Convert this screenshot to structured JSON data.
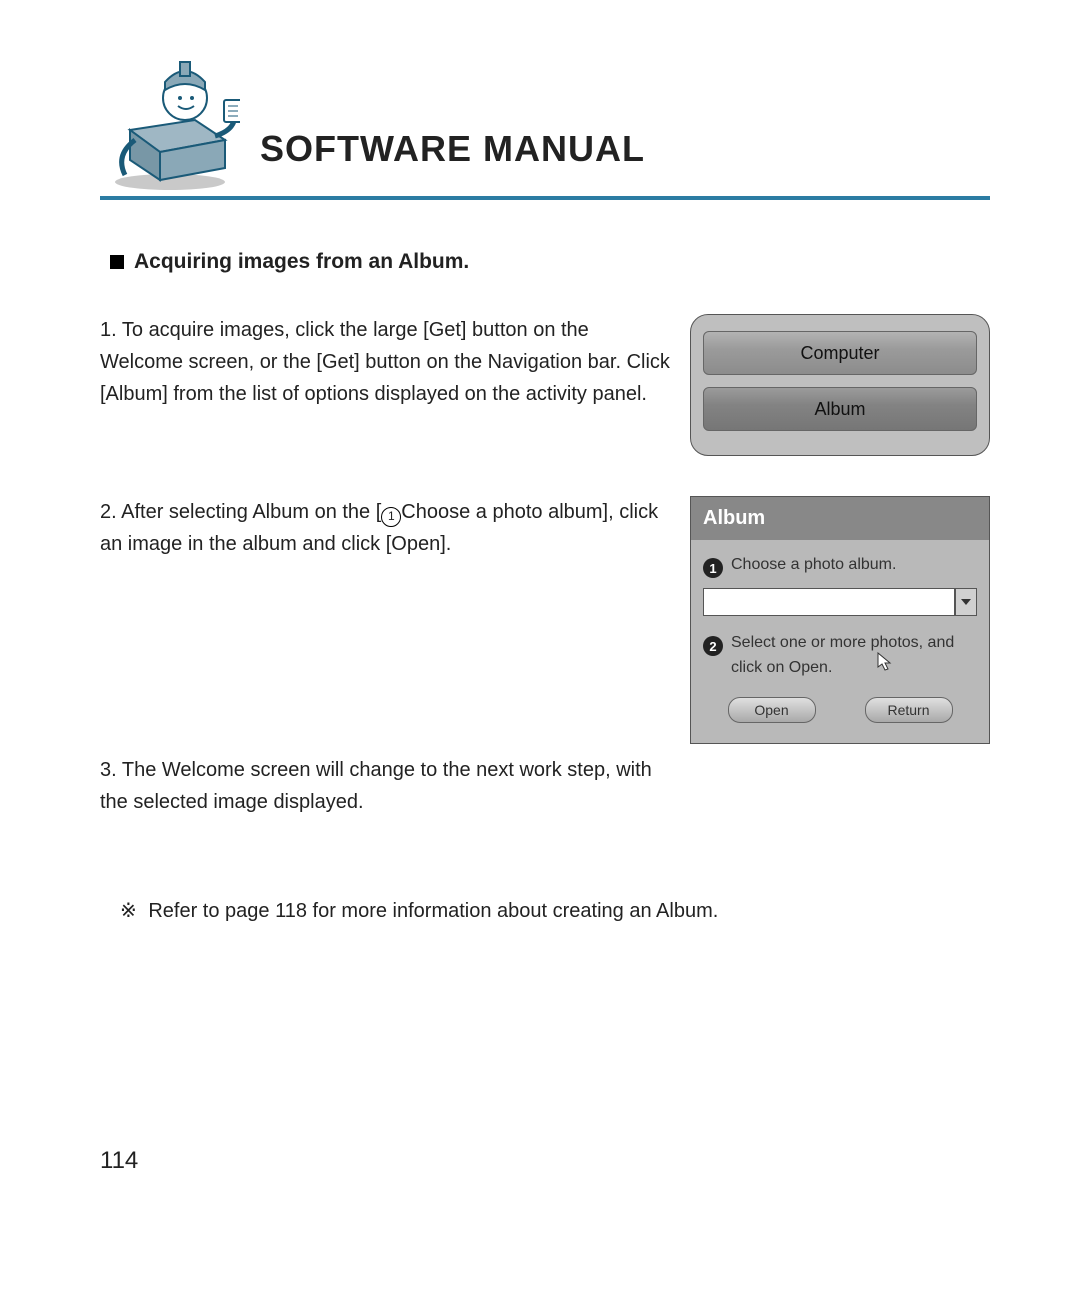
{
  "header": {
    "title": "SOFTWARE MANUAL"
  },
  "section": {
    "heading": "Acquiring images from an Album."
  },
  "steps": {
    "s1_num": "1.",
    "s1_text": " To acquire images, click the large [Get] button on the Welcome screen, or the [Get] button on the Navigation bar. Click [Album] from the list of options displayed on the activity panel.",
    "s2_num": "2.",
    "s2_pre": " After selecting Album on the [",
    "s2_inline_num": "1",
    "s2_post": "Choose a photo album], click an image in the album and click [Open].",
    "s3_num": "3.",
    "s3_text": " The Welcome screen will change to the next work step, with the selected image displayed."
  },
  "fig1": {
    "btn_computer": "Computer",
    "btn_album": "Album"
  },
  "fig2": {
    "title": "Album",
    "step1_num": "1",
    "step1_label": "Choose a photo album.",
    "step2_num": "2",
    "step2_label": "Select one or more photos, and click on Open.",
    "open_btn": "Open",
    "return_btn": "Return"
  },
  "note_mark": "※",
  "note_text": " Refer to page 118 for more information about creating an Album.",
  "page_number": "114"
}
